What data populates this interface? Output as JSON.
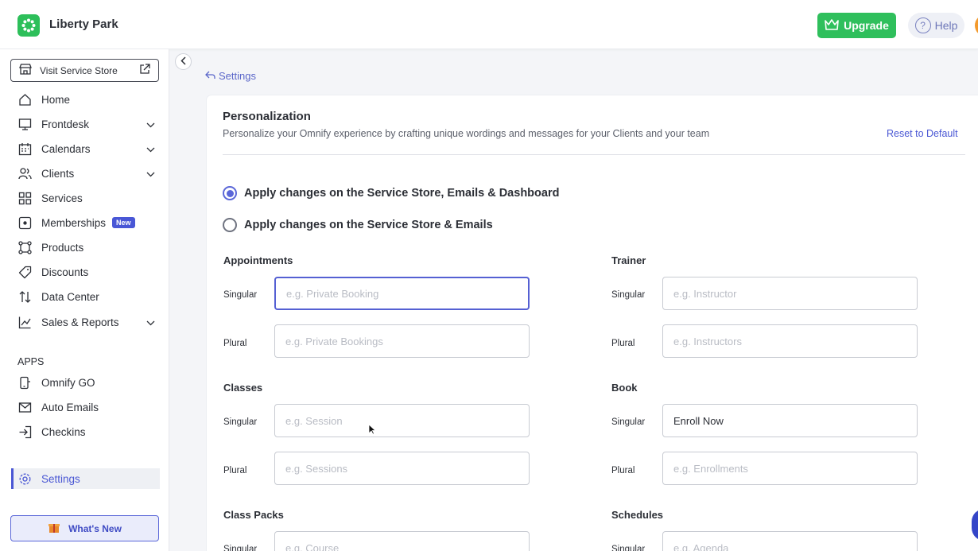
{
  "header": {
    "brand": "Liberty Park",
    "upgrade_label": "Upgrade",
    "help_label": "Help"
  },
  "sidebar": {
    "visit_store": "Visit Service Store",
    "items": [
      {
        "label": "Home",
        "icon": "home-icon"
      },
      {
        "label": "Frontdesk",
        "icon": "monitor-icon",
        "expandable": true
      },
      {
        "label": "Calendars",
        "icon": "calendar-icon",
        "expandable": true
      },
      {
        "label": "Clients",
        "icon": "users-icon",
        "expandable": true
      },
      {
        "label": "Services",
        "icon": "grid-icon"
      },
      {
        "label": "Memberships",
        "icon": "membership-icon",
        "badge": "New"
      },
      {
        "label": "Products",
        "icon": "products-icon"
      },
      {
        "label": "Discounts",
        "icon": "tag-icon"
      },
      {
        "label": "Data Center",
        "icon": "transfer-icon"
      },
      {
        "label": "Sales & Reports",
        "icon": "chart-icon",
        "expandable": true
      }
    ],
    "apps_label": "APPS",
    "apps": [
      {
        "label": "Omnify GO",
        "icon": "mobile-icon"
      },
      {
        "label": "Auto Emails",
        "icon": "mail-icon"
      },
      {
        "label": "Checkins",
        "icon": "checkin-icon"
      }
    ],
    "settings_label": "Settings",
    "whats_new": "What's New"
  },
  "breadcrumb": "Settings",
  "panel": {
    "title": "Personalization",
    "subtitle": "Personalize your Omnify experience by crafting unique wordings and messages for your Clients and your team",
    "reset_label": "Reset to Default",
    "radio_options": [
      {
        "label": "Apply changes on the Service Store, Emails & Dashboard",
        "checked": true
      },
      {
        "label": "Apply changes on the Service Store & Emails",
        "checked": false
      }
    ],
    "groups": {
      "appointments": {
        "title": "Appointments",
        "singular_label": "Singular",
        "plural_label": "Plural",
        "singular_placeholder": "e.g. Private Booking",
        "plural_placeholder": "e.g. Private Bookings",
        "singular_value": "",
        "plural_value": ""
      },
      "trainer": {
        "title": "Trainer",
        "singular_label": "Singular",
        "plural_label": "Plural",
        "singular_placeholder": "e.g. Instructor",
        "plural_placeholder": "e.g. Instructors",
        "singular_value": "",
        "plural_value": ""
      },
      "classes": {
        "title": "Classes",
        "singular_label": "Singular",
        "plural_label": "Plural",
        "singular_placeholder": "e.g. Session",
        "plural_placeholder": "e.g. Sessions",
        "singular_value": "",
        "plural_value": ""
      },
      "book": {
        "title": "Book",
        "singular_label": "Singular",
        "plural_label": "Plural",
        "singular_placeholder": "",
        "plural_placeholder": "e.g. Enrollments",
        "singular_value": "Enroll Now",
        "plural_value": ""
      },
      "class_packs": {
        "title": "Class Packs",
        "singular_label": "Singular",
        "singular_placeholder": "e.g. Course"
      },
      "schedules": {
        "title": "Schedules",
        "singular_label": "Singular",
        "singular_placeholder": "e.g. Agenda"
      }
    }
  },
  "colors": {
    "accent": "#4a57d4",
    "upgrade": "#2fbf5c",
    "brand_logo": "#2dbf5a"
  }
}
